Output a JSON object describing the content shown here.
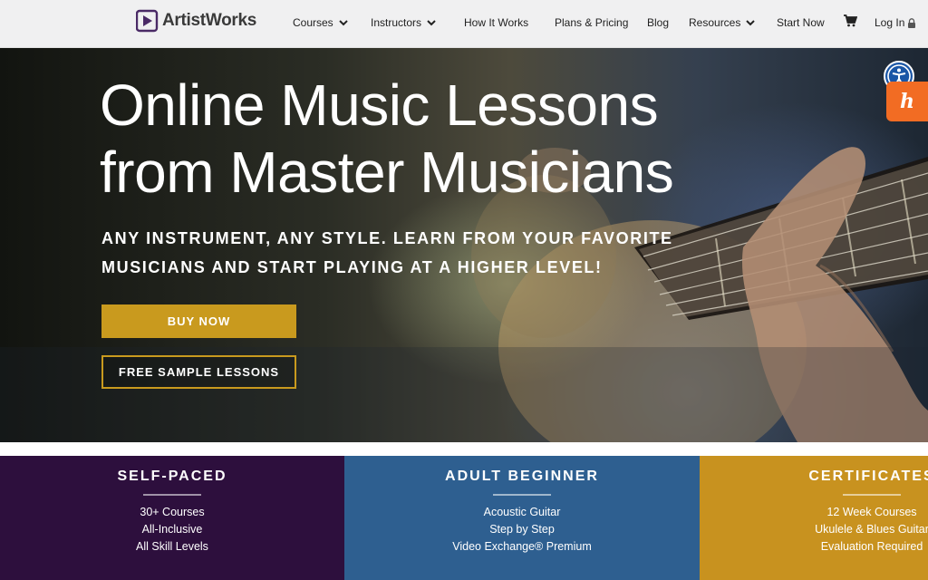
{
  "header": {
    "logo_text": "ArtistWorks",
    "nav": [
      {
        "label": "Courses",
        "dropdown": true
      },
      {
        "label": "Instructors",
        "dropdown": true
      },
      {
        "label": "How It Works",
        "dropdown": false
      },
      {
        "label": "Plans & Pricing",
        "dropdown": false
      },
      {
        "label": "Blog",
        "dropdown": false
      },
      {
        "label": "Resources",
        "dropdown": true
      },
      {
        "label": "Start Now",
        "dropdown": false
      }
    ],
    "login_label": "Log In",
    "icons": {
      "cart": "cart-icon",
      "lock": "lock-icon"
    }
  },
  "hero": {
    "title_line1": "Online Music Lessons",
    "title_line2": "from Master Musicians",
    "subtitle_line1": "ANY INSTRUMENT, ANY STYLE. LEARN FROM YOUR FAVORITE",
    "subtitle_line2": "MUSICIANS AND START PLAYING AT A HIGHER LEVEL!",
    "buy_label": "BUY NOW",
    "free_label": "FREE SAMPLE LESSONS"
  },
  "cards": [
    {
      "title": "SELF-PACED",
      "items": [
        "30+ Courses",
        "All-Inclusive",
        "All Skill Levels"
      ],
      "color": "#2d0f3d"
    },
    {
      "title": "ADULT BEGINNER",
      "items": [
        "Acoustic Guitar",
        "Step by Step",
        "Video Exchange® Premium"
      ],
      "color": "#2e5f90"
    },
    {
      "title": "CERTIFICATES",
      "items": [
        "12 Week Courses",
        "Ukulele & Blues Guitar",
        "Evaluation Required"
      ],
      "color": "#c8921f"
    }
  ],
  "colors": {
    "accent_gold": "#c99a1e",
    "header_bg": "#f0f0f1",
    "accessibility_blue": "#1a56a6",
    "honey_orange": "#f26c23"
  }
}
